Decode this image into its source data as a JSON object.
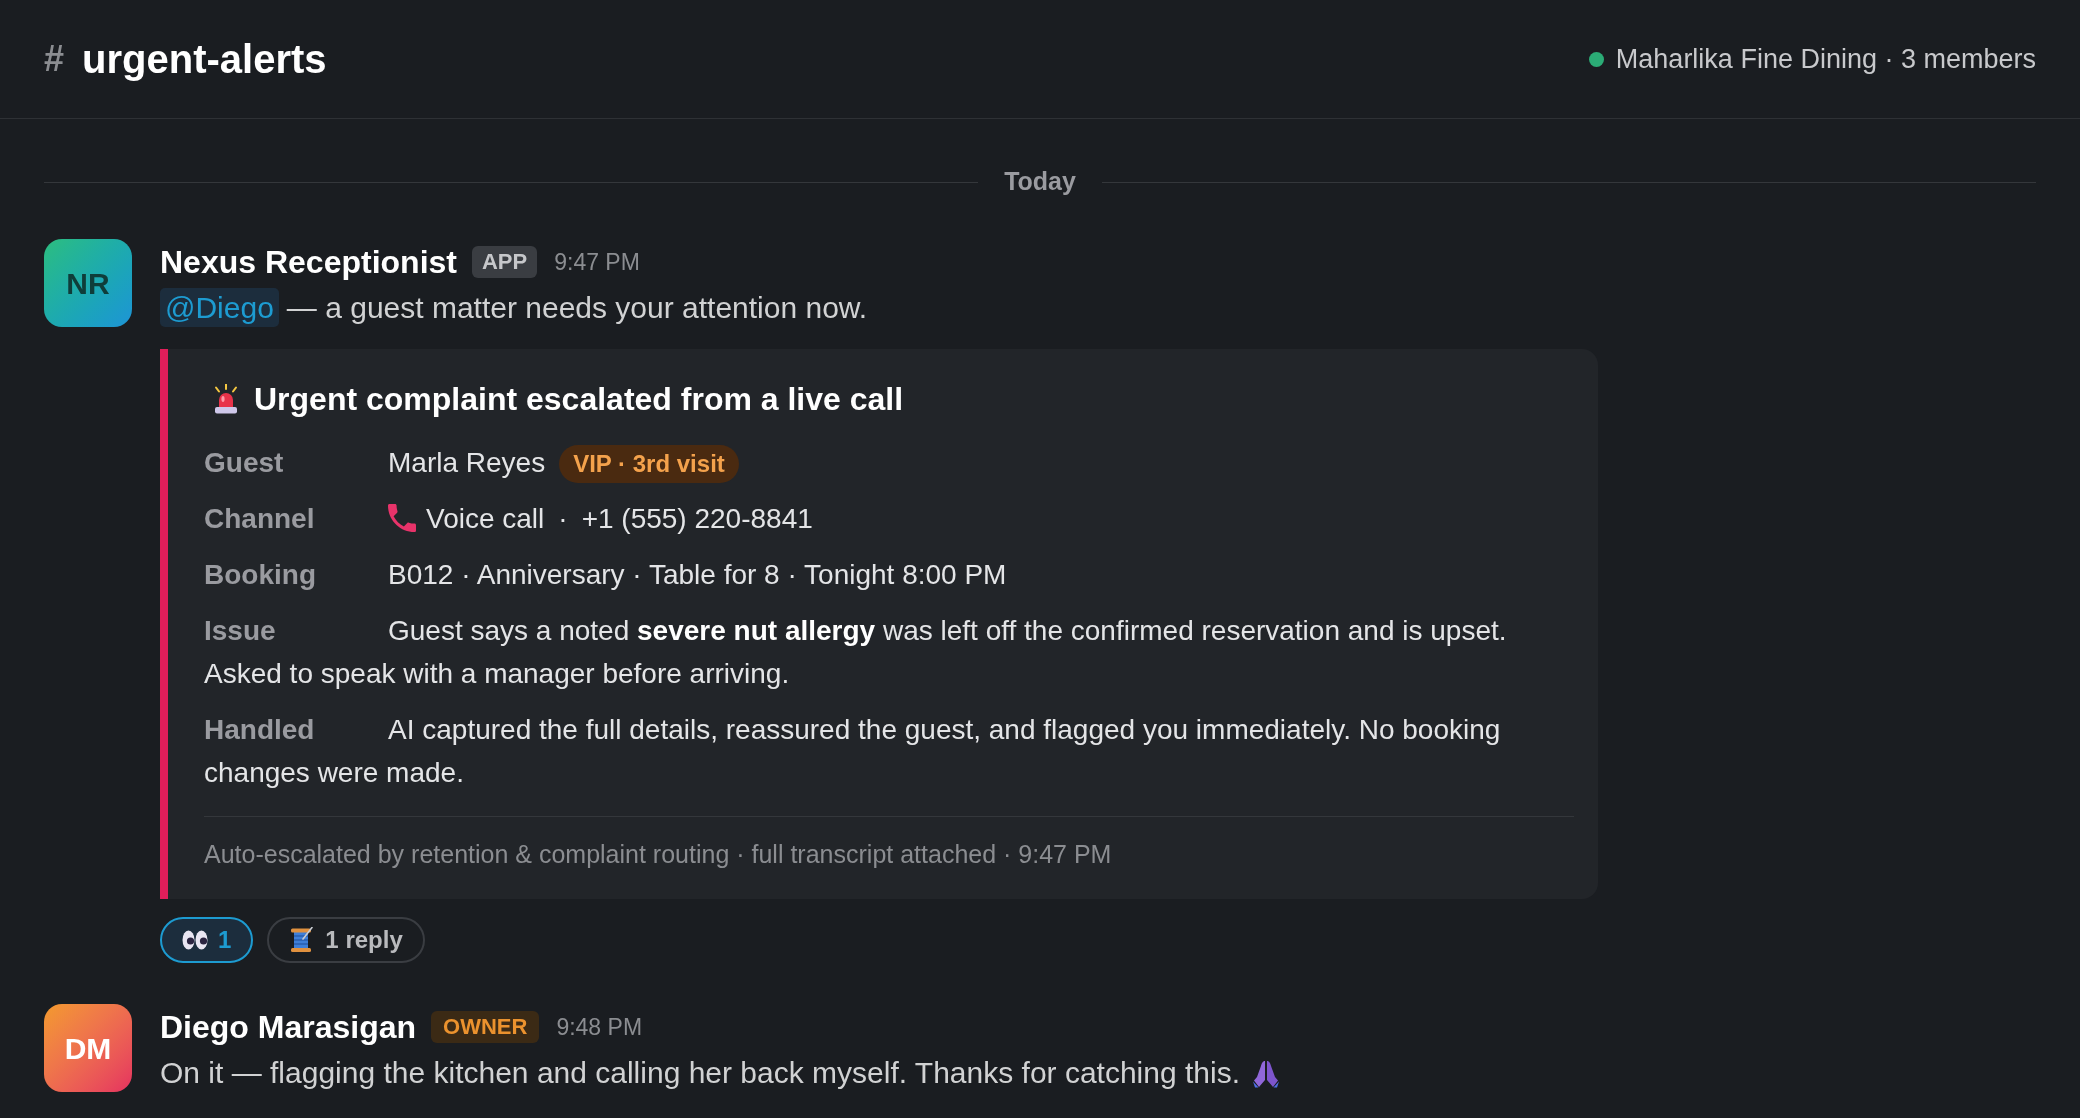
{
  "channel": {
    "hash": "#",
    "name": "urgent-alerts",
    "online": true,
    "workspace": "Maharlika Fine Dining · 3 members"
  },
  "date_divider": "Today",
  "messages": [
    {
      "kind": "app",
      "initials": "NR",
      "author": "Nexus Receptionist",
      "role": "APP",
      "time": "9:47 PM",
      "mention": "@Diego",
      "text": "— a guest matter needs your attention now.",
      "attachment": {
        "urgent": true,
        "title": "Urgent complaint escalated from a live call",
        "fields": [
          {
            "kind": "tagged",
            "label": "Guest",
            "value": "Marla Reyes",
            "tag": "VIP · 3rd visit"
          },
          {
            "kind": "phone",
            "label": "Channel",
            "value": "Voice call",
            "separator": "·",
            "detail": "+1 (555) 220-8841"
          },
          {
            "kind": "text",
            "label": "Booking",
            "value": "B012 · Anniversary · Table for 8 · Tonight 8:00 PM"
          },
          {
            "kind": "text",
            "label": "Issue",
            "value": "Guest says a noted **severe nut allergy** was left off the confirmed reservation and is upset. Asked to speak with a manager before arriving."
          },
          {
            "kind": "text",
            "label": "Handled",
            "value": "AI captured the full details, reassured the guest, and flagged you immediately. No booking changes were made."
          }
        ],
        "footer": "Auto-escalated by retention & complaint routing · full transcript attached · 9:47 PM"
      },
      "reactions": [
        {
          "count": "1",
          "selected": true
        }
      ],
      "thread": {
        "label": "1 reply"
      }
    },
    {
      "kind": "member",
      "initials": "DM",
      "author": "Diego Marasigan",
      "role": "OWNER",
      "time": "9:48 PM",
      "text": "On it — flagging the kitchen and calling her back myself. Thanks for catching this.",
      "trailing_icon": true
    }
  ]
}
